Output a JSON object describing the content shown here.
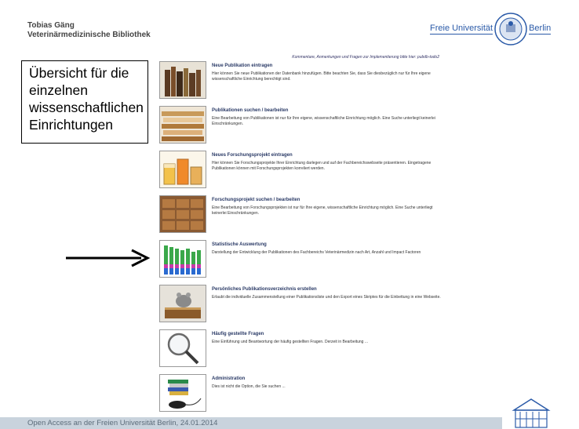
{
  "header": {
    "author_name": "Tobias Gäng",
    "library_name": "Veterinärmedizinische Bibliothek"
  },
  "logo": {
    "left_text": "Freie Universität",
    "right_text": "Berlin",
    "seal_icon": "university-seal-icon"
  },
  "contact_note": "Kommentare, Anmerkungen und Fragen zur Implementierung bitte hier: pubdb-todo2",
  "callout": {
    "line1": "Übersicht für die",
    "line2": "einzelnen",
    "line3": "wissenschaftlichen",
    "line4": "Einrichtungen"
  },
  "menu": [
    {
      "title": "Neue Publikation eintragen",
      "description": "Hier können Sie neue Publikationen der Datenbank hinzufügen. Bitte beachten Sie, dass Sie diesbezüglich nur für Ihre eigene wissenschaftliche Einrichtung berechtigt sind.",
      "icon": "books-icon"
    },
    {
      "title": "Publikationen suchen / bearbeiten",
      "description": "Eine Bearbeitung von Publikationen ist nur für Ihre eigene, wissenschaftliche Einrichtung möglich. Eine Suche unterliegt keinerlei Einschränkungen.",
      "icon": "book-stacks-icon"
    },
    {
      "title": "Neues Forschungsprojekt eintragen",
      "description": "Hier können Sie Forschungsprojekte Ihrer Einrichtung darlegen und auf der Fachbereichswebseite präsentieren. Eingetragene Publikationen können mit Forschungsprojekten korreliert werden.",
      "icon": "lab-beakers-icon"
    },
    {
      "title": "Forschungsprojekt suchen / bearbeiten",
      "description": "Eine Bearbeitung von Forschungsprojekten ist nur für Ihre eigene, wissenschaftliche Einrichtung möglich. Eine Suche unterliegt keinerlei Einschränkungen.",
      "icon": "card-catalog-icon"
    },
    {
      "title": "Statistische Auswertung",
      "description": "Darstellung der Entwicklung der Publikationen des Fachbereichs Veterinärmedizin nach Art, Anzahl und Impact Factoren",
      "icon": "bar-chart-icon"
    },
    {
      "title": "Persönliches Publikationsverzeichnis erstellen",
      "description": "Erlaubt die individuelle Zusammenstellung einer Publikationsliste und den Export eines Skriptes für die Einbettung in eine Webseite.",
      "icon": "mouse-on-book-icon"
    },
    {
      "title": "Häufig gestellte Fragen",
      "description": "Eine Einführung und Beantwortung der häufig gestellten Fragen. Derzeit in Bearbeitung ...",
      "icon": "magnifier-icon"
    },
    {
      "title": "Administration",
      "description": "Dies ist nicht die Option, die Sie suchen ...",
      "icon": "books-and-mouse-icon"
    }
  ],
  "footer": {
    "text": "Open Access an der Freien Universität Berlin, 24.01.2014"
  },
  "colors": {
    "title_blue": "#2a3a66",
    "footer_bg": "#c9d3dd",
    "logo_blue": "#2a5aa8"
  }
}
